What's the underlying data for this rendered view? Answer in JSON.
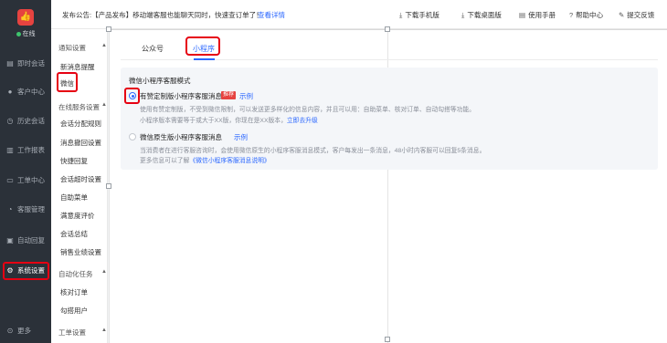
{
  "nav": {
    "status_label": "在线",
    "items": [
      {
        "label": "即时会话",
        "icon": "chat-icon"
      },
      {
        "label": "客户中心",
        "icon": "user-icon"
      },
      {
        "label": "历史会话",
        "icon": "history-icon"
      },
      {
        "label": "工作报表",
        "icon": "report-icon"
      },
      {
        "label": "工单中心",
        "icon": "ticket-icon"
      },
      {
        "label": "客服管理",
        "icon": "headset-icon"
      },
      {
        "label": "自动回复",
        "icon": "auto-reply-icon"
      },
      {
        "label": "系统设置",
        "icon": "gear-icon"
      },
      {
        "label": "更多",
        "icon": "more-icon"
      }
    ],
    "active_index": 7
  },
  "topbar": {
    "notice": "发布公告:【产品发布】移动端客服也能聊天同时，快速查订单了！",
    "detail_link": "查看详情",
    "actions": [
      "下载手机版",
      "下载桌面版",
      "使用手册",
      "帮助中心",
      "提交反馈"
    ]
  },
  "subnav": {
    "groups": [
      {
        "label": "通知设置",
        "items": [
          "新消息提醒",
          "微信"
        ]
      },
      {
        "label": "在线服务设置",
        "items": [
          "会话分配规则",
          "消息撤回设置",
          "快捷回复",
          "会话超时设置",
          "自助菜单",
          "满意度评价",
          "会话总结",
          "销售业绩设置"
        ]
      },
      {
        "label": "自动化任务",
        "items": [
          "核对订单",
          "勾搭用户"
        ]
      },
      {
        "label": "工单设置",
        "items": []
      }
    ]
  },
  "tabs": [
    {
      "label": "公众号",
      "active": false
    },
    {
      "label": "小程序",
      "active": true
    }
  ],
  "section_title": "微信小程序客服模式",
  "options": [
    {
      "title": "有赞定制版小程序客服消息",
      "badge": "推荐",
      "example": "示例",
      "selected": true,
      "desc1": "使用有赞定制版，不受到微信限制，可以发送更多样化的信息内容，并且可以用：自助菜单、核对订单、自动勾搭等功能。",
      "desc2": "小程序版本需要等于或大于XX版，你现在是XX版本，",
      "desc2_link": "立即去升级"
    },
    {
      "title": "微信原生版小程序客服消息",
      "example": "示例",
      "selected": false,
      "desc1": "当消费者在进行客服咨询时，会使用微信原生的小程序客服消息模式，客户每发出一条消息，48小时内客服可以回复5条消息。",
      "desc2": "更多信息可以了解",
      "desc2_link": "《微信小程序客服消息说明》"
    }
  ],
  "colors": {
    "accent": "#2c68ff",
    "highlight": "#e60012",
    "nav_bg": "#2b3139",
    "badge": "#e64340"
  }
}
